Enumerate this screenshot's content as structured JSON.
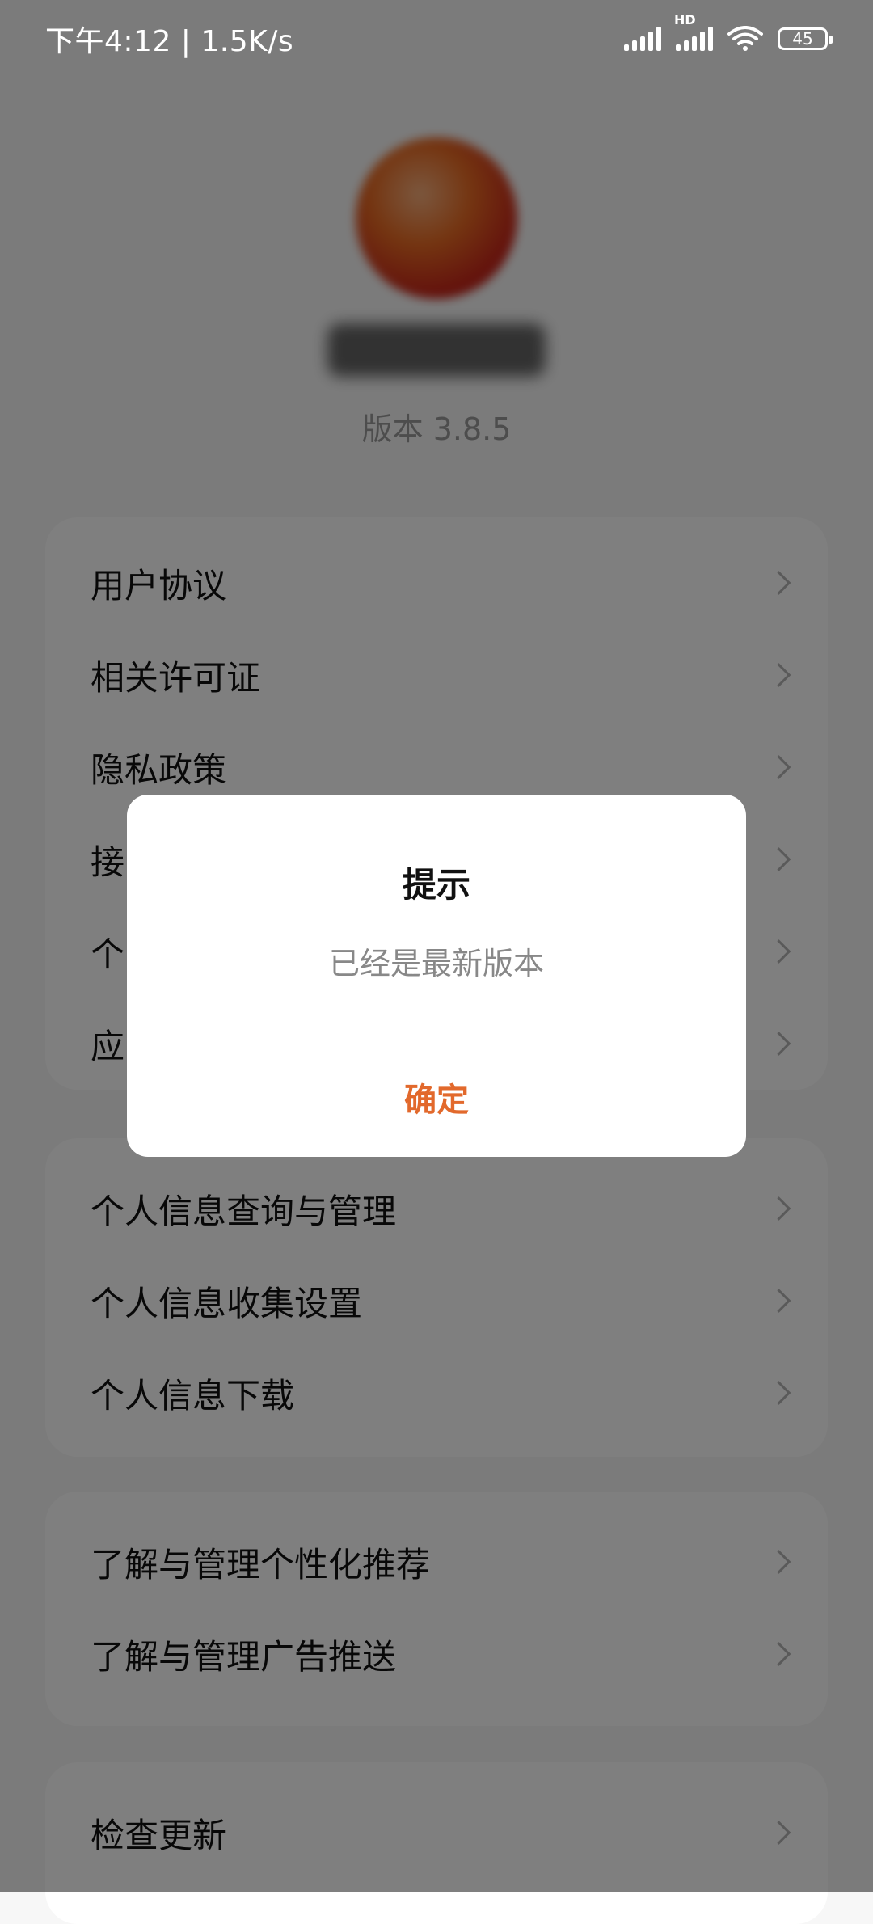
{
  "status_bar": {
    "time_speed": "下午4:12 | 1.5K/s",
    "hd_label": "HD",
    "battery": "45",
    "icons": [
      "signal-icon",
      "hd-signal-icon",
      "wifi-icon",
      "battery-icon"
    ]
  },
  "header": {
    "version": "版本 3.8.5",
    "logo_colors": [
      "#e96b23",
      "#c8261a"
    ]
  },
  "sections": {
    "group1": [
      {
        "label": "用户协议"
      },
      {
        "label": "相关许可证"
      },
      {
        "label": "隐私政策"
      },
      {
        "label": "接"
      },
      {
        "label": "个"
      },
      {
        "label": "应"
      }
    ],
    "group2": [
      {
        "label": "个人信息查询与管理"
      },
      {
        "label": "个人信息收集设置"
      },
      {
        "label": "个人信息下载"
      }
    ],
    "group3": [
      {
        "label": "了解与管理个性化推荐"
      },
      {
        "label": "了解与管理广告推送"
      }
    ],
    "group4": [
      {
        "label": "检查更新"
      }
    ]
  },
  "dialog": {
    "title": "提示",
    "message": "已经是最新版本",
    "confirm_label": "确定",
    "accent_color": "#e2692c"
  }
}
